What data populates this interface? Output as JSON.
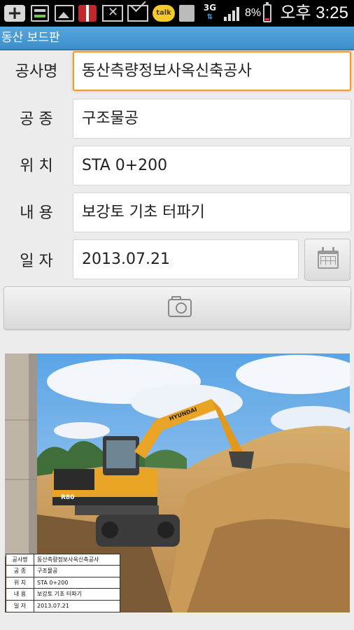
{
  "status_bar": {
    "network": "3G",
    "battery_percent": "8%",
    "time": "오후 3:25",
    "icons": [
      "add-icon",
      "storage-bars-icon",
      "gallery-icon",
      "gift-icon",
      "mail-error-icon",
      "mail-check-icon",
      "kakaotalk-icon",
      "sd-card-icon",
      "signal-icon",
      "battery-icon"
    ],
    "kakaotalk_badge": "talk"
  },
  "app": {
    "title": "동산 보드판"
  },
  "form": {
    "project_name": {
      "label": "공사명",
      "value": "동산측량정보사옥신축공사"
    },
    "work_type": {
      "label": "공 종",
      "value": "구조물공"
    },
    "location": {
      "label": "위 치",
      "value": "STA 0+200"
    },
    "content": {
      "label": "내 용",
      "value": "보강토 기초 터파기"
    },
    "date": {
      "label": "일 자",
      "value": "2013.07.21"
    }
  },
  "buttons": {
    "calendar_icon": "calendar-icon",
    "camera_icon": "camera-icon"
  },
  "photo": {
    "excavator_brand": "HYUNDAI",
    "excavator_model": "R80",
    "board": [
      {
        "label": "공사명",
        "value": "동산측량정보사옥신축공사"
      },
      {
        "label": "공 종",
        "value": "구조물공"
      },
      {
        "label": "위 치",
        "value": "STA 0+200"
      },
      {
        "label": "내 용",
        "value": "보강토 기초 터파기"
      },
      {
        "label": "일 자",
        "value": "2013.07.21"
      }
    ]
  },
  "colors": {
    "title_bar": "#4a9ad6",
    "focus_border": "#f29a2e",
    "status_bar": "#000000",
    "background": "#ececec"
  }
}
